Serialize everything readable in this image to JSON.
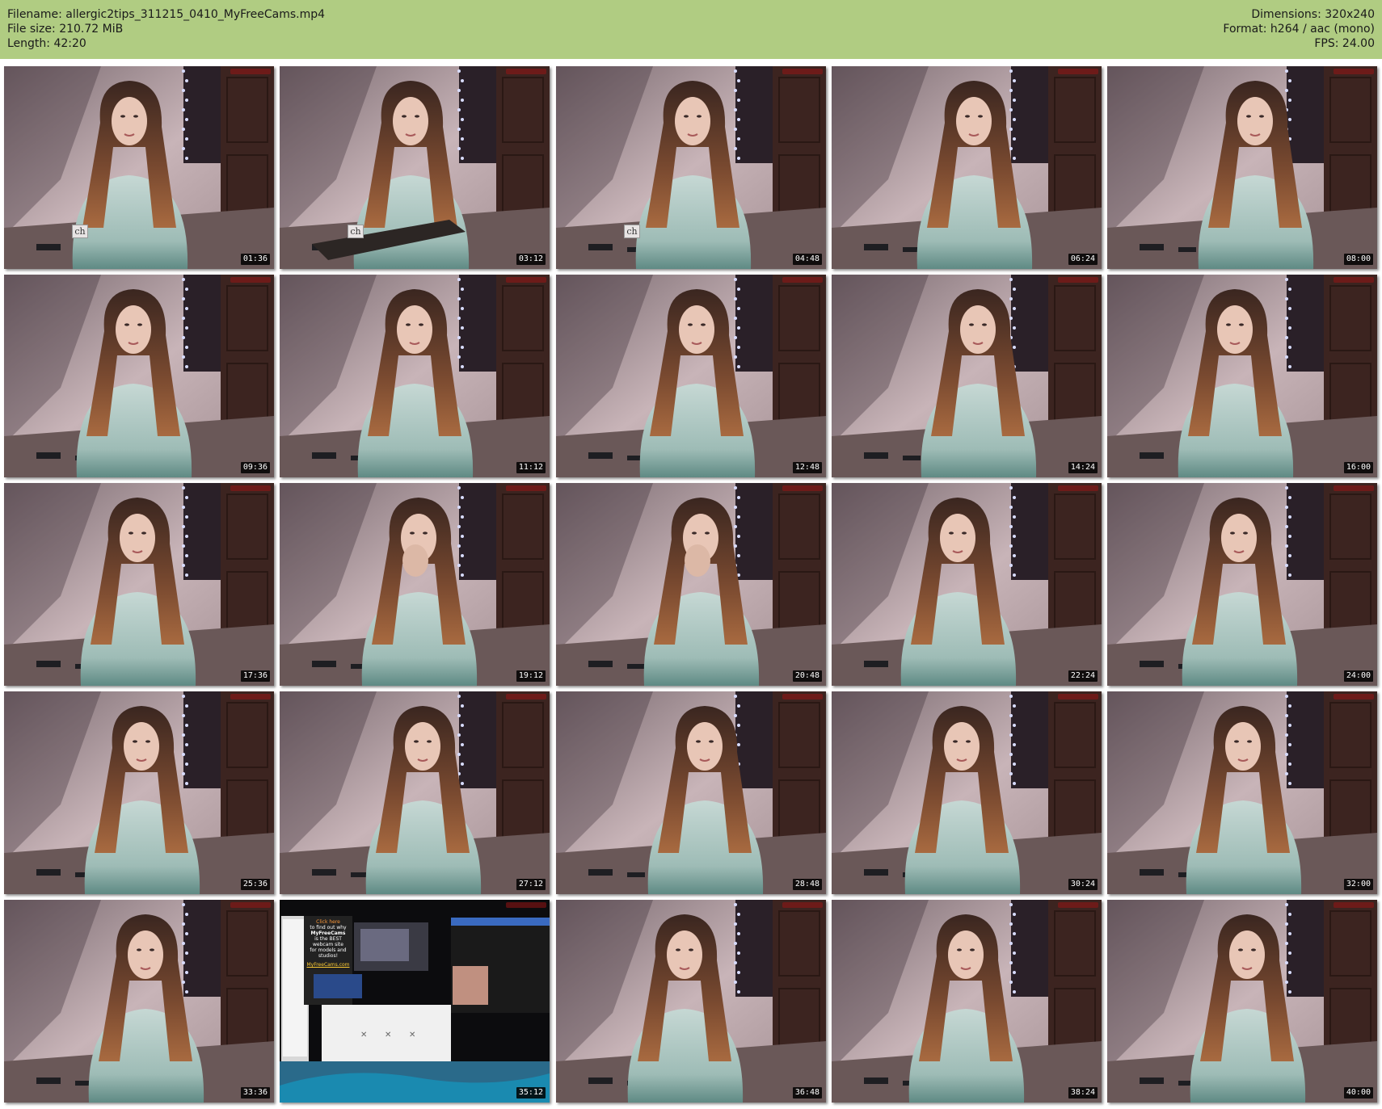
{
  "header": {
    "filename_line": "Filename: allergic2tips_311215_0410_MyFreeCams.mp4",
    "filesize_line": "File size: 210.72 MiB",
    "length_line": "Length: 42:20",
    "dimensions_line": "Dimensions: 320x240",
    "format_line": "Format: h264 / aac (mono)",
    "fps_line": "FPS: 24.00",
    "background_color": "#b0cc82"
  },
  "thumbnails": [
    {
      "time": "01:36",
      "scene": "room",
      "badge": "ch"
    },
    {
      "time": "03:12",
      "scene": "room-laptop",
      "badge": "ch"
    },
    {
      "time": "04:48",
      "scene": "room",
      "badge": "ch"
    },
    {
      "time": "06:24",
      "scene": "room"
    },
    {
      "time": "08:00",
      "scene": "room"
    },
    {
      "time": "09:36",
      "scene": "room"
    },
    {
      "time": "11:12",
      "scene": "room"
    },
    {
      "time": "12:48",
      "scene": "room"
    },
    {
      "time": "14:24",
      "scene": "room"
    },
    {
      "time": "16:00",
      "scene": "room"
    },
    {
      "time": "17:36",
      "scene": "room"
    },
    {
      "time": "19:12",
      "scene": "room-hand"
    },
    {
      "time": "20:48",
      "scene": "room-hand"
    },
    {
      "time": "22:24",
      "scene": "room"
    },
    {
      "time": "24:00",
      "scene": "room"
    },
    {
      "time": "25:36",
      "scene": "room"
    },
    {
      "time": "27:12",
      "scene": "room"
    },
    {
      "time": "28:48",
      "scene": "room"
    },
    {
      "time": "30:24",
      "scene": "room"
    },
    {
      "time": "32:00",
      "scene": "room"
    },
    {
      "time": "33:36",
      "scene": "room"
    },
    {
      "time": "35:12",
      "scene": "ad-screen"
    },
    {
      "time": "36:48",
      "scene": "room"
    },
    {
      "time": "38:24",
      "scene": "room"
    },
    {
      "time": "40:00",
      "scene": "room"
    }
  ],
  "ad_screen": {
    "line1": "Click here",
    "line2": "to find out why",
    "line3": "MyFreeCams",
    "line4": "is the BEST",
    "line5": "webcam site",
    "line6": "for models and",
    "line7": "studios!",
    "link": "MyFreeCams.com"
  }
}
